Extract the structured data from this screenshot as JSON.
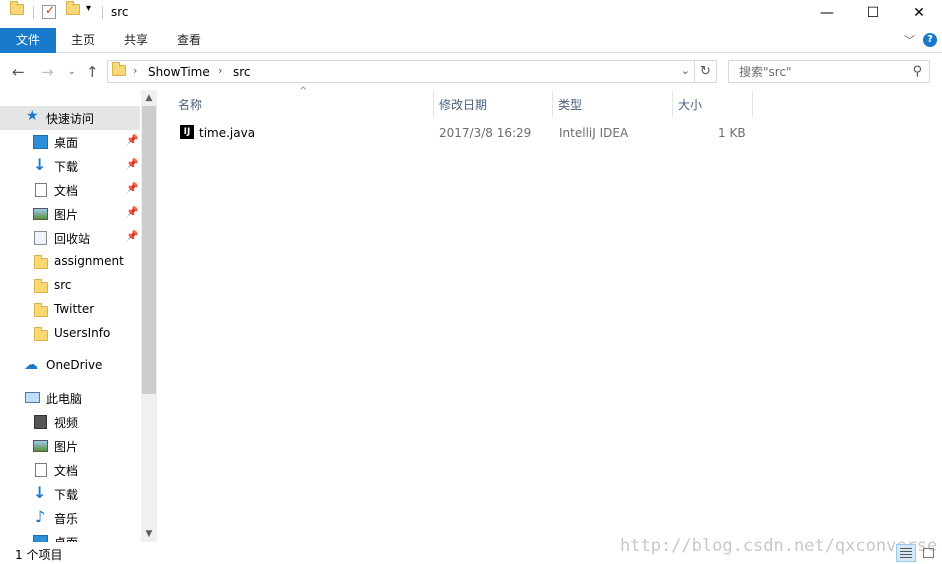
{
  "window": {
    "title": "src",
    "controls": {
      "minimize": "—",
      "maximize": "☐",
      "close": "✕"
    }
  },
  "ribbon": {
    "tabs": [
      "文件",
      "主页",
      "共享",
      "查看"
    ],
    "help": "?"
  },
  "address": {
    "crumbs": [
      "ShowTime",
      "src"
    ],
    "search_placeholder": "搜索\"src\""
  },
  "nav": {
    "quick_access": "快速访问",
    "pinned": [
      "桌面",
      "下载",
      "文档",
      "图片",
      "回收站"
    ],
    "folders": [
      "assignment",
      "src",
      "Twitter",
      "UsersInfo"
    ],
    "onedrive": "OneDrive",
    "this_pc": "此电脑",
    "pc_items": [
      "视频",
      "图片",
      "文档",
      "下载",
      "音乐",
      "桌面"
    ]
  },
  "columns": {
    "name": "名称",
    "modified": "修改日期",
    "type": "类型",
    "size": "大小"
  },
  "files": [
    {
      "name": "time.java",
      "modified": "2017/3/8 16:29",
      "type": "IntelliJ IDEA",
      "size": "1 KB",
      "icon": "intellij-icon"
    }
  ],
  "status": {
    "item_count": "1 个项目"
  },
  "watermark": "http://blog.csdn.net/qxconverse",
  "colors": {
    "accent": "#1979ca",
    "selected": "#cce8ff",
    "header_text": "#4c607a"
  }
}
